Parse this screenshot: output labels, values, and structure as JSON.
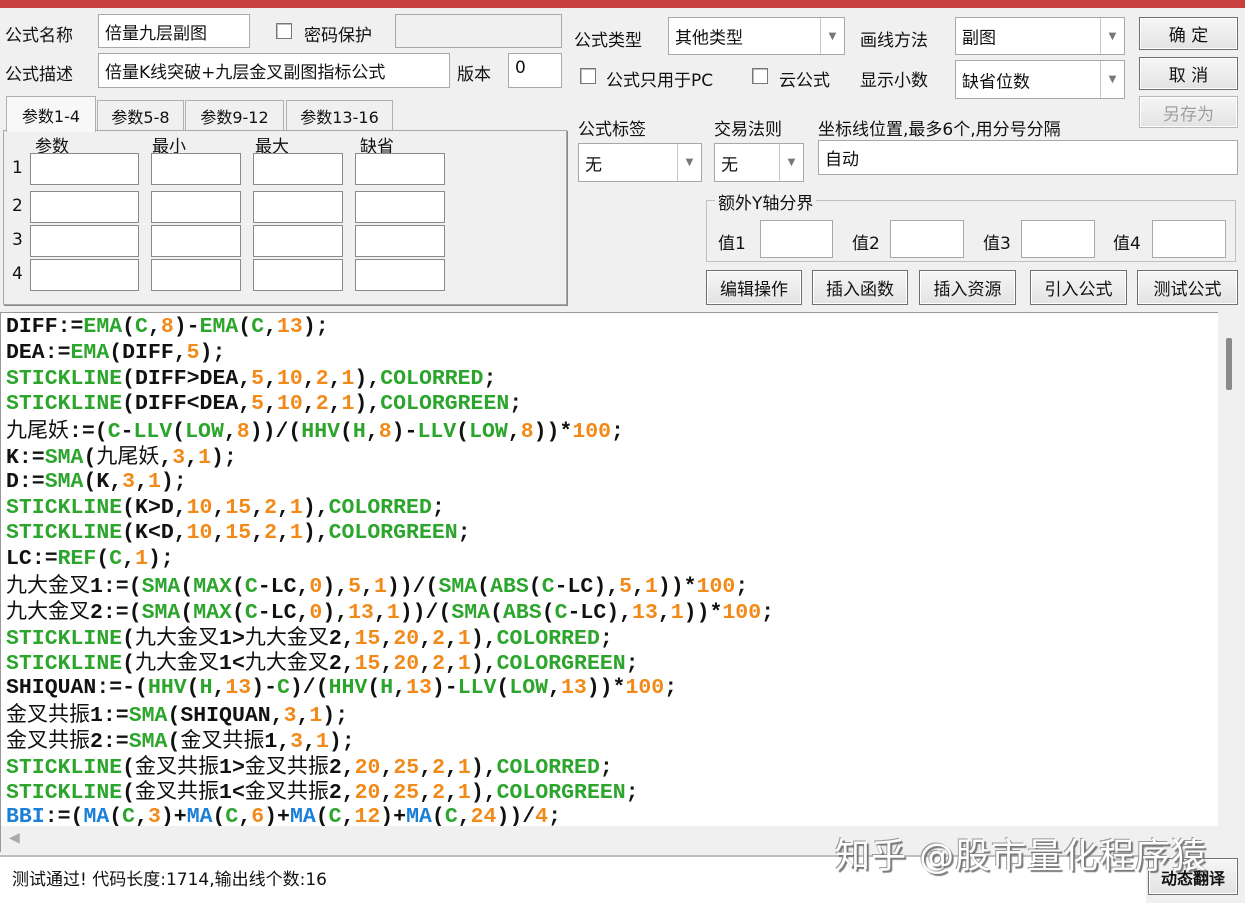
{
  "form": {
    "name_label": "公式名称",
    "name_value": "倍量九层副图",
    "password_label": "密码保护",
    "password_value": "",
    "desc_label": "公式描述",
    "desc_value": "倍量K线突破+九层金叉副图指标公式",
    "version_label": "版本",
    "version_value": "0",
    "type_label": "公式类型",
    "type_value": "其他类型",
    "draw_label": "画线方法",
    "draw_value": "副图",
    "pc_only_label": "公式只用于PC",
    "cloud_label": "云公式",
    "decimals_label": "显示小数",
    "decimals_value": "缺省位数",
    "tag_label": "公式标签",
    "tag_value": "无",
    "trade_label": "交易法则",
    "trade_value": "无",
    "axis_label": "坐标线位置,最多6个,用分号分隔",
    "axis_value": "自动",
    "yaxis_group": "额外Y轴分界",
    "yvals": [
      "值1",
      "值2",
      "值3",
      "值4"
    ]
  },
  "buttons": {
    "ok": "确 定",
    "cancel": "取 消",
    "save_as": "另存为",
    "edit": "编辑操作",
    "insert_func": "插入函数",
    "insert_res": "插入资源",
    "import": "引入公式",
    "test": "测试公式",
    "translate": "动态翻译"
  },
  "tabs": [
    "参数1-4",
    "参数5-8",
    "参数9-12",
    "参数13-16"
  ],
  "params": {
    "headers": [
      "参数",
      "最小",
      "最大",
      "缺省"
    ],
    "rows": [
      "1",
      "2",
      "3",
      "4"
    ]
  },
  "code": [
    "DIFF:=EMA(C,8)-EMA(C,13);",
    "DEA:=EMA(DIFF,5);",
    "STICKLINE(DIFF>DEA,5,10,2,1),COLORRED;",
    "STICKLINE(DIFF<DEA,5,10,2,1),COLORGREEN;",
    "九尾妖:=(C-LLV(LOW,8))/(HHV(H,8)-LLV(LOW,8))*100;",
    "K:=SMA(九尾妖,3,1);",
    "D:=SMA(K,3,1);",
    "STICKLINE(K>D,10,15,2,1),COLORRED;",
    "STICKLINE(K<D,10,15,2,1),COLORGREEN;",
    "LC:=REF(C,1);",
    "九大金叉1:=(SMA(MAX(C-LC,0),5,1))/(SMA(ABS(C-LC),5,1))*100;",
    "九大金叉2:=(SMA(MAX(C-LC,0),13,1))/(SMA(ABS(C-LC),13,1))*100;",
    "STICKLINE(九大金叉1>九大金叉2,15,20,2,1),COLORRED;",
    "STICKLINE(九大金叉1<九大金叉2,15,20,2,1),COLORGREEN;",
    "SHIQUAN:=-(HHV(H,13)-C)/(HHV(H,13)-LLV(LOW,13))*100;",
    "金叉共振1:=SMA(SHIQUAN,3,1);",
    "金叉共振2:=SMA(金叉共振1,3,1);",
    "STICKLINE(金叉共振1>金叉共振2,20,25,2,1),COLORRED;",
    "STICKLINE(金叉共振1<金叉共振2,20,25,2,1),COLORGREEN;",
    "BBI:=(MA(C,3)+MA(C,6)+MA(C,12)+MA(C,24))/4;"
  ],
  "status": "测试通过! 代码长度:1714,输出线个数:16",
  "watermark": "知乎 @股市量化程序猿",
  "colors": {
    "keyword": "#2ca52c",
    "number": "#f28a1a",
    "blue": "#1a7fd6",
    "titlebar": "#c8403f"
  }
}
